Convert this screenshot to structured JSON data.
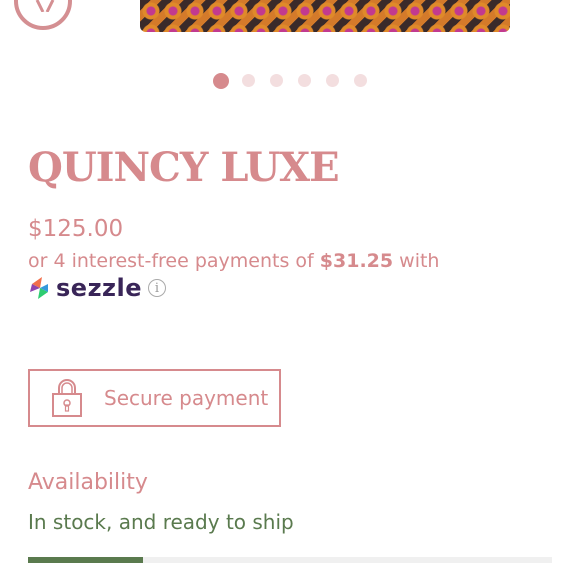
{
  "product": {
    "title": "QUINCY LUXE",
    "price": "$125.00",
    "installments_prefix": "or 4 interest-free payments of ",
    "installment_amount": "$31.25",
    "installments_suffix": " with",
    "payment_provider": "sezzle"
  },
  "carousel": {
    "dot_count": 6,
    "active_index": 0
  },
  "secure": {
    "label": "Secure payment",
    "icon": "lock-icon"
  },
  "availability": {
    "label": "Availability",
    "status": "In stock, and ready to ship",
    "stock_fraction": 0.22
  },
  "colors": {
    "accent": "#d68a8d",
    "stock_green": "#5a7a4e",
    "sezzle_purple": "#392558"
  }
}
